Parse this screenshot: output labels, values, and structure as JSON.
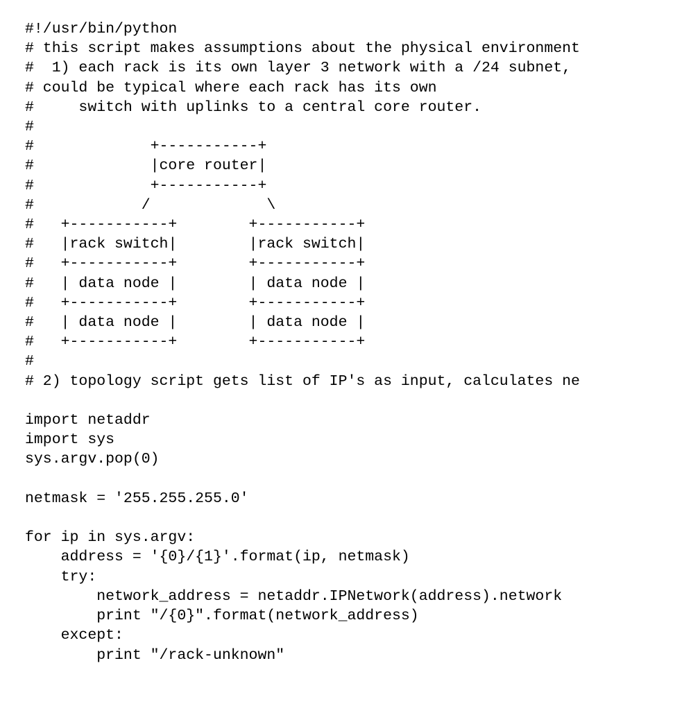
{
  "code_lines": [
    "#!/usr/bin/python",
    "# this script makes assumptions about the physical environment",
    "#  1) each rack is its own layer 3 network with a /24 subnet,",
    "# could be typical where each rack has its own",
    "#     switch with uplinks to a central core router.",
    "#",
    "#             +-----------+",
    "#             |core router|",
    "#             +-----------+",
    "#            /             \\",
    "#   +-----------+        +-----------+",
    "#   |rack switch|        |rack switch|",
    "#   +-----------+        +-----------+",
    "#   | data node |        | data node |",
    "#   +-----------+        +-----------+",
    "#   | data node |        | data node |",
    "#   +-----------+        +-----------+",
    "#",
    "# 2) topology script gets list of IP's as input, calculates ne",
    "",
    "import netaddr",
    "import sys",
    "sys.argv.pop(0)",
    "",
    "netmask = '255.255.255.0'",
    "",
    "for ip in sys.argv:",
    "    address = '{0}/{1}'.format(ip, netmask)",
    "    try:",
    "        network_address = netaddr.IPNetwork(address).network",
    "        print \"/{0}\".format(network_address)",
    "    except:",
    "        print \"/rack-unknown\""
  ]
}
